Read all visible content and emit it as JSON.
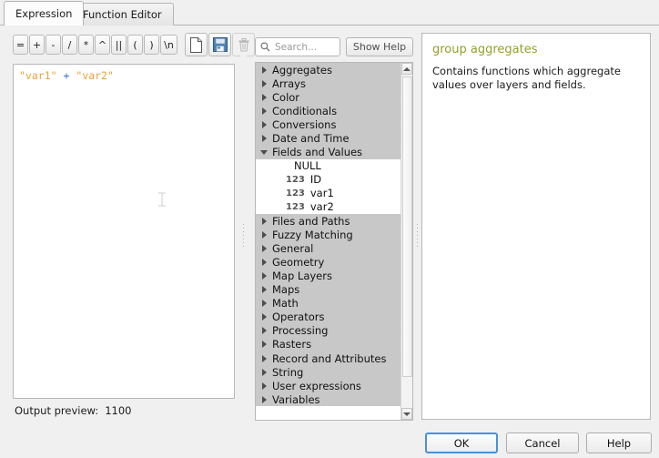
{
  "tabs": [
    {
      "label": "Expression",
      "active": true
    },
    {
      "label": "Function Editor",
      "active": false
    }
  ],
  "toolbar": {
    "operators": [
      "=",
      "+",
      "-",
      "/",
      "*",
      "^",
      "||",
      "(",
      ")",
      "\\n"
    ],
    "icons": [
      {
        "name": "new-file-icon",
        "enabled": true
      },
      {
        "name": "save-icon",
        "enabled": true
      },
      {
        "name": "delete-icon",
        "enabled": false
      }
    ]
  },
  "expression": {
    "tokens": [
      {
        "text": "\"var1\"",
        "type": "field"
      },
      {
        "text": " ",
        "type": "plain"
      },
      {
        "text": "+",
        "type": "operator"
      },
      {
        "text": " ",
        "type": "plain"
      },
      {
        "text": "\"var2\"",
        "type": "field"
      }
    ],
    "full_text": "\"var1\" + \"var2\""
  },
  "preview": {
    "label": "Output preview:",
    "value": "1100"
  },
  "search": {
    "placeholder": "Search...",
    "value": "",
    "icon": "search-icon"
  },
  "show_help_button": "Show Help",
  "tree": [
    {
      "label": "Aggregates",
      "type": "group",
      "expanded": false
    },
    {
      "label": "Arrays",
      "type": "group",
      "expanded": false
    },
    {
      "label": "Color",
      "type": "group",
      "expanded": false
    },
    {
      "label": "Conditionals",
      "type": "group",
      "expanded": false
    },
    {
      "label": "Conversions",
      "type": "group",
      "expanded": false
    },
    {
      "label": "Date and Time",
      "type": "group",
      "expanded": false
    },
    {
      "label": "Fields and Values",
      "type": "group",
      "expanded": true
    },
    {
      "label": "NULL",
      "type": "leaf",
      "icon": ""
    },
    {
      "label": "ID",
      "type": "leaf",
      "icon": "123"
    },
    {
      "label": "var1",
      "type": "leaf",
      "icon": "123"
    },
    {
      "label": "var2",
      "type": "leaf",
      "icon": "123"
    },
    {
      "label": "Files and Paths",
      "type": "group",
      "expanded": false
    },
    {
      "label": "Fuzzy Matching",
      "type": "group",
      "expanded": false
    },
    {
      "label": "General",
      "type": "group",
      "expanded": false
    },
    {
      "label": "Geometry",
      "type": "group",
      "expanded": false
    },
    {
      "label": "Map Layers",
      "type": "group",
      "expanded": false
    },
    {
      "label": "Maps",
      "type": "group",
      "expanded": false
    },
    {
      "label": "Math",
      "type": "group",
      "expanded": false
    },
    {
      "label": "Operators",
      "type": "group",
      "expanded": false
    },
    {
      "label": "Processing",
      "type": "group",
      "expanded": false
    },
    {
      "label": "Rasters",
      "type": "group",
      "expanded": false
    },
    {
      "label": "Record and Attributes",
      "type": "group",
      "expanded": false
    },
    {
      "label": "String",
      "type": "group",
      "expanded": false
    },
    {
      "label": "User expressions",
      "type": "group",
      "expanded": false
    },
    {
      "label": "Variables",
      "type": "group",
      "expanded": false
    }
  ],
  "help": {
    "title": "group aggregates",
    "body": "Contains functions which aggregate values over layers and fields."
  },
  "buttons": {
    "ok": "OK",
    "cancel": "Cancel",
    "help": "Help"
  },
  "colors": {
    "field_token": "#e8a33d",
    "operator_token": "#3a6fd8",
    "help_title": "#93a127",
    "group_row_bg": "#c8c8c8",
    "ok_focus_border": "#4a90d9"
  }
}
